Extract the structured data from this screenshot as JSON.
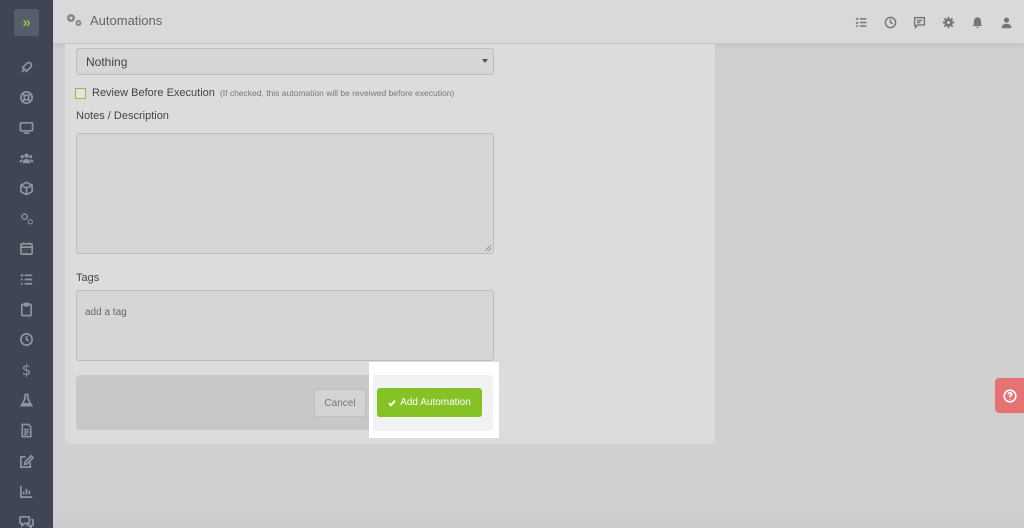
{
  "header": {
    "title": "Automations",
    "title_icon": "gears-icon",
    "icons": [
      "checklist-icon",
      "clock-icon",
      "chat-icon",
      "gear-icon",
      "bell-icon",
      "user-icon"
    ]
  },
  "sidebar": {
    "logo_glyph": "»",
    "items": [
      {
        "icon": "rocket-icon"
      },
      {
        "icon": "lifebuoy-icon"
      },
      {
        "icon": "monitor-icon"
      },
      {
        "icon": "users-icon"
      },
      {
        "icon": "box-icon"
      },
      {
        "icon": "gears-icon"
      },
      {
        "icon": "calendar-icon"
      },
      {
        "icon": "list-icon"
      },
      {
        "icon": "clipboard-icon"
      },
      {
        "icon": "clock-icon"
      },
      {
        "icon": "dollar-icon",
        "glyph": "$"
      },
      {
        "icon": "flask-icon"
      },
      {
        "icon": "document-icon"
      },
      {
        "icon": "edit-icon"
      },
      {
        "icon": "chart-icon"
      },
      {
        "icon": "chat-icon"
      }
    ]
  },
  "form": {
    "select_value": "Nothing",
    "review_label": "Review Before Execution",
    "review_hint": "(If checked, this automation will be reveiwed before execution)",
    "notes_label": "Notes / Description",
    "notes_value": "",
    "tags_label": "Tags",
    "tags_placeholder": "add a tag",
    "cancel_label": "Cancel",
    "submit_label": "Add Automation"
  },
  "colors": {
    "accent": "#84c225",
    "sidebar": "#3f4553",
    "help": "#e57373"
  }
}
